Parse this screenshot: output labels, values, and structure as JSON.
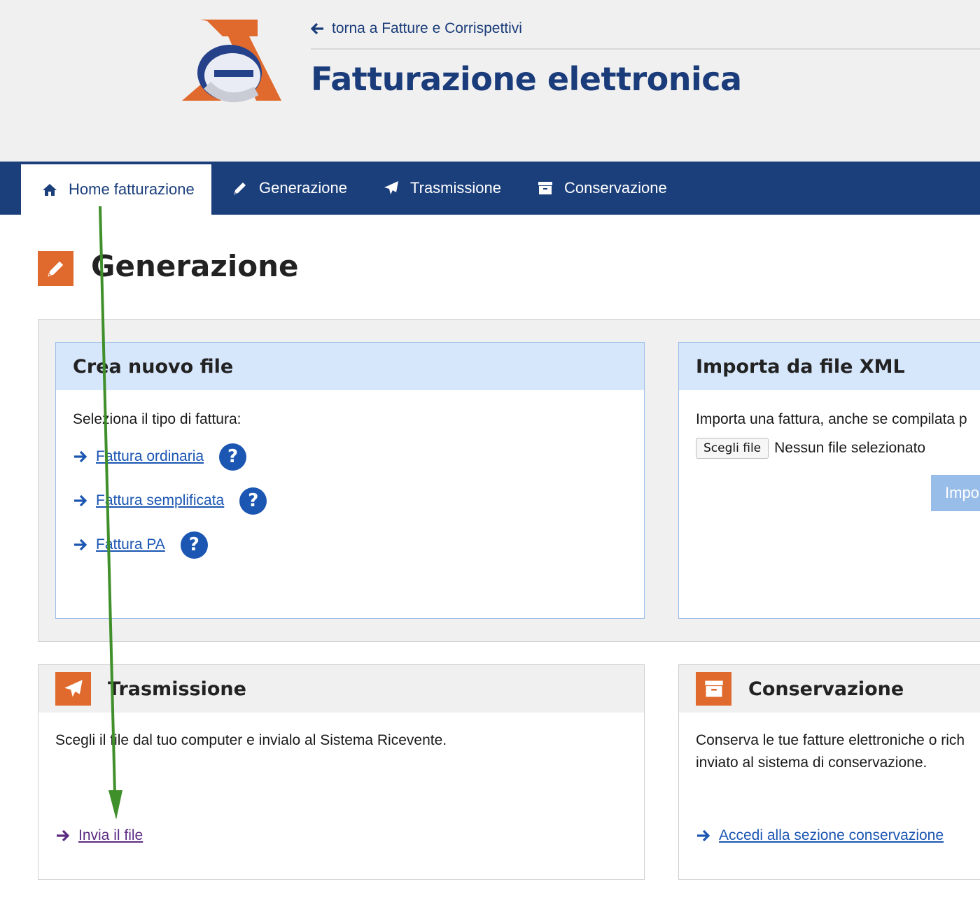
{
  "header": {
    "back_link": "torna a Fatture e Corrispettivi",
    "title": "Fatturazione elettronica"
  },
  "nav": {
    "items": [
      {
        "label": "Home fatturazione",
        "icon": "home-icon",
        "active": true
      },
      {
        "label": "Generazione",
        "icon": "pencil-icon",
        "active": false
      },
      {
        "label": "Trasmissione",
        "icon": "paper-plane-icon",
        "active": false
      },
      {
        "label": "Conservazione",
        "icon": "archive-icon",
        "active": false
      }
    ]
  },
  "page": {
    "title": "Generazione"
  },
  "crea": {
    "title": "Crea nuovo file",
    "prompt": "Seleziona il tipo di fattura:",
    "links": [
      {
        "label": "Fattura ordinaria",
        "help": "?"
      },
      {
        "label": "Fattura semplificata",
        "help": "?"
      },
      {
        "label": "Fattura PA",
        "help": "?"
      }
    ]
  },
  "importa": {
    "title": "Importa da file XML",
    "text": "Importa una fattura, anche se compilata p",
    "file_button": "Scegli file",
    "file_status": "Nessun file selezionato",
    "import_button": "Impo"
  },
  "trasmissione": {
    "title": "Trasmissione",
    "text": "Scegli il file dal tuo computer e invialo al Sistema Ricevente.",
    "link": "Invia il file"
  },
  "conservazione": {
    "title": "Conservazione",
    "text_line1": "Conserva le tue fatture elettroniche o rich",
    "text_line2": "inviato al sistema di conservazione.",
    "link": "Accedi alla sezione conservazione"
  },
  "colors": {
    "brand_blue": "#1b3f7b",
    "link_blue": "#1b56b2",
    "accent_orange": "#e06a2d",
    "visited_purple": "#5b2b82",
    "annotation_green": "#3f8f2a"
  }
}
